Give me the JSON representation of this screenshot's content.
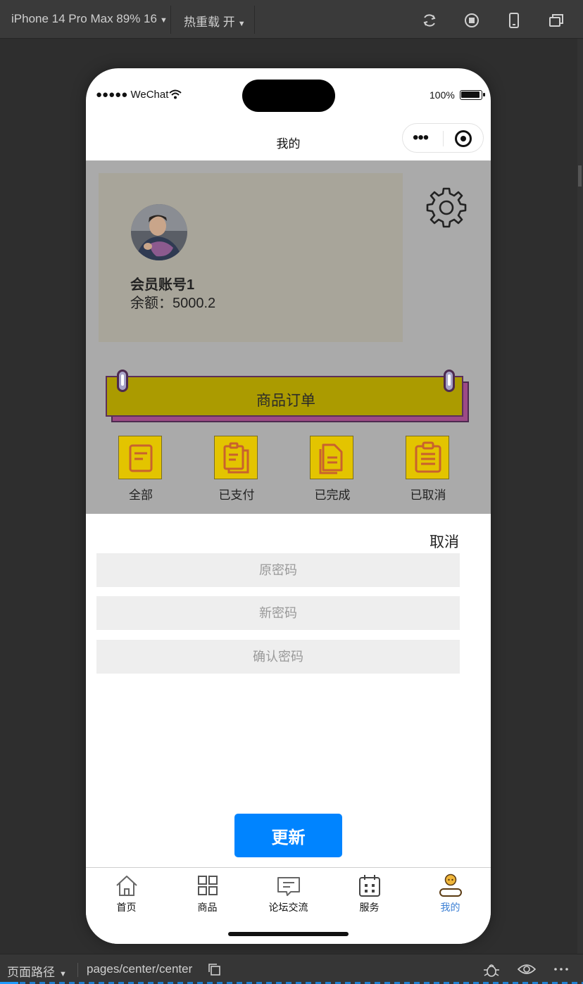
{
  "toolbar": {
    "device": "iPhone 14 Pro Max 89% 16",
    "hot_reload": "热重载 开"
  },
  "statusbar": {
    "carrier": "●●●●● WeChat",
    "battery": "100%"
  },
  "navbar": {
    "title": "我的",
    "more_dots": "•••"
  },
  "profile": {
    "username": "会员账号1",
    "balance_label": "余额：",
    "balance_value": "5000.2"
  },
  "orders": {
    "title": "商品订单",
    "categories": [
      {
        "label": "全部",
        "icon": "document-icon"
      },
      {
        "label": "已支付",
        "icon": "clipboard-copy-icon"
      },
      {
        "label": "已完成",
        "icon": "file-done-icon"
      },
      {
        "label": "已取消",
        "icon": "clipboard-list-icon"
      }
    ]
  },
  "password_form": {
    "cancel_label": "取消",
    "old_placeholder": "原密码",
    "new_placeholder": "新密码",
    "confirm_placeholder": "确认密码",
    "submit_label": "更新"
  },
  "tabbar": {
    "items": [
      {
        "label": "首页",
        "icon": "home-icon"
      },
      {
        "label": "商品",
        "icon": "grid-icon"
      },
      {
        "label": "论坛交流",
        "icon": "chat-icon"
      },
      {
        "label": "服务",
        "icon": "calendar-icon"
      },
      {
        "label": "我的",
        "icon": "user-icon",
        "active": true
      }
    ],
    "active_color": "#3b7fd4"
  },
  "bottombar": {
    "path_label": "页面路径",
    "path_value": "pages/center/center"
  },
  "colors": {
    "header_bg": "#aaaaaa",
    "profile_card_bg": "#a8a59a",
    "banner_bg": "#ab9b00",
    "category_bg": "#e3c400",
    "button_bg": "#0084ff"
  }
}
